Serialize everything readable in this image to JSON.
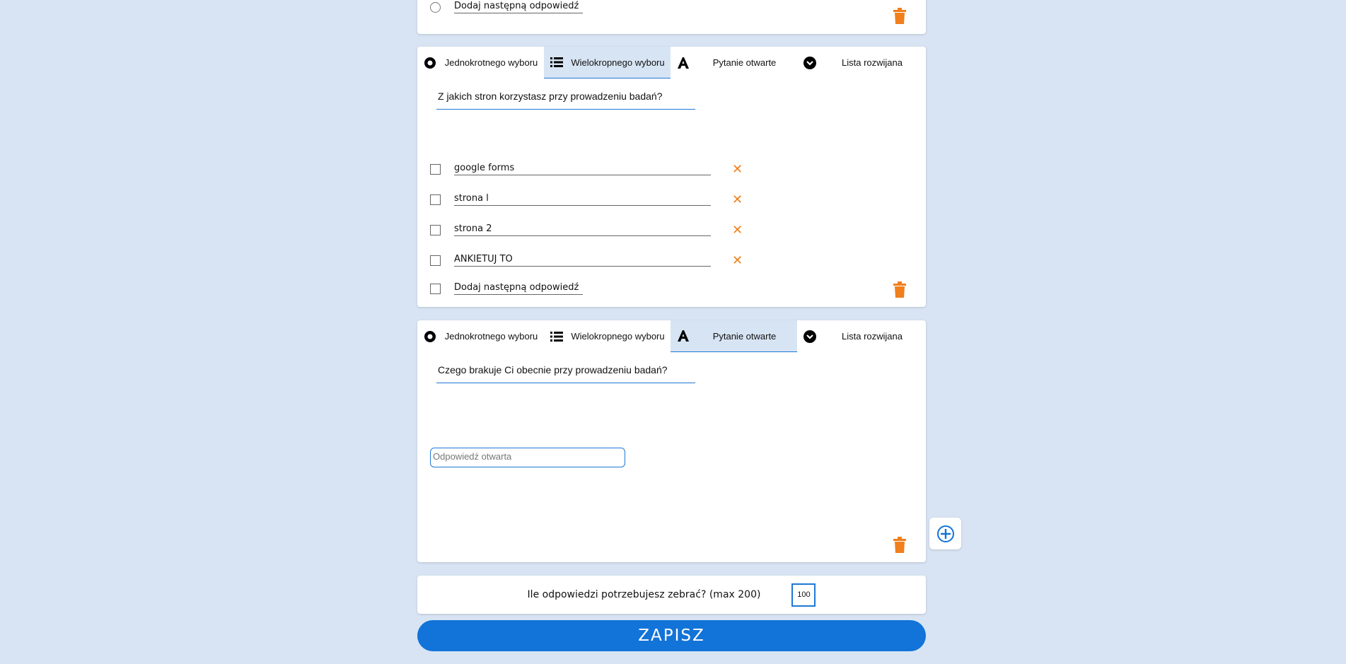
{
  "top_card": {
    "add_option_label": "Dodaj następną odpowiedź"
  },
  "question_types": {
    "single": "Jednokrotnego wyboru",
    "multi": "Wielokropnego wyboru",
    "open": "Pytanie otwarte",
    "dropdown": "Lista rozwijana"
  },
  "q2": {
    "active_type": "multi",
    "question": "Z jakich stron korzystasz przy prowadzeniu badań?",
    "options": [
      "google forms",
      "strona l",
      "strona 2",
      "ANKIETUJ TO"
    ],
    "add_option_label": "Dodaj następną odpowiedź"
  },
  "q3": {
    "active_type": "open",
    "question": "Czego brakuje Ci obecnie przy prowadzeniu badań?",
    "answer_placeholder": "Odpowiedź otwarta"
  },
  "responses": {
    "label": "Ile odpowiedzi potrzebujesz zebrać? (max 200)",
    "value": "100"
  },
  "save_label": "ZAPISZ",
  "colors": {
    "background": "#d8e4f3",
    "accent": "#1273d8",
    "delete": "#f07f1c"
  }
}
